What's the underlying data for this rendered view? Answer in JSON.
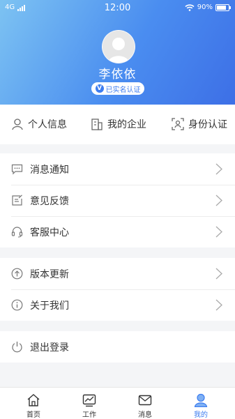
{
  "status_bar": {
    "network": "4G",
    "time": "12:00",
    "battery": "90%",
    "battery_level": 0.9
  },
  "profile": {
    "name": "李依依",
    "verified_label": "已实名认证",
    "verified_mark": "V"
  },
  "quick_actions": [
    {
      "label": "个人信息",
      "icon": "person-icon"
    },
    {
      "label": "我的企业",
      "icon": "building-icon"
    },
    {
      "label": "身份认证",
      "icon": "id-scan-icon"
    }
  ],
  "menu_groups": [
    [
      {
        "label": "消息通知",
        "icon": "message-icon"
      },
      {
        "label": "意见反馈",
        "icon": "feedback-icon"
      },
      {
        "label": "客服中心",
        "icon": "headset-icon"
      }
    ],
    [
      {
        "label": "版本更新",
        "icon": "upgrade-icon"
      },
      {
        "label": "关于我们",
        "icon": "info-icon"
      }
    ],
    [
      {
        "label": "退出登录",
        "icon": "power-icon"
      }
    ]
  ],
  "tabs": [
    {
      "label": "首页",
      "icon": "home-icon"
    },
    {
      "label": "工作",
      "icon": "chart-icon"
    },
    {
      "label": "消息",
      "icon": "mail-icon"
    },
    {
      "label": "我的",
      "icon": "user-icon",
      "active": true
    }
  ],
  "colors": {
    "accent": "#3d7df0",
    "gradient_start": "#7dc3f2",
    "gradient_end": "#3d6fe6"
  }
}
